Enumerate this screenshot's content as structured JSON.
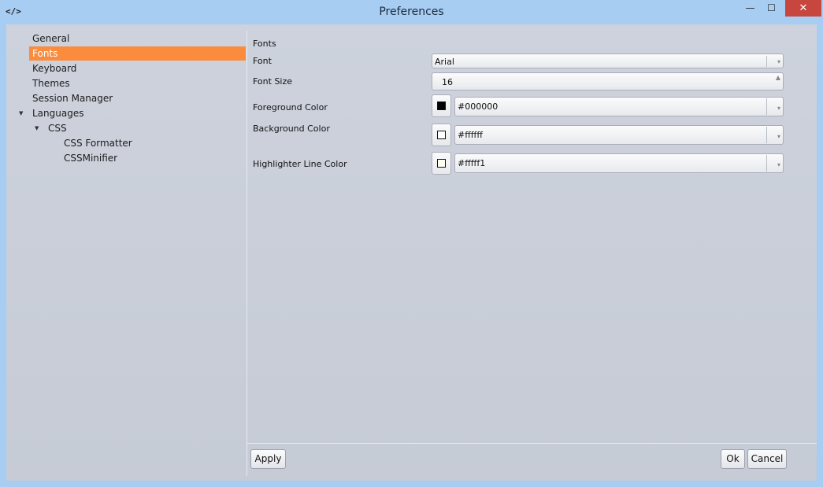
{
  "window": {
    "title": "Preferences",
    "app_icon": "</>",
    "controls": {
      "minimize": "—",
      "maximize": "☐",
      "close": "✕"
    }
  },
  "sidebar": {
    "items": [
      {
        "label": "General"
      },
      {
        "label": "Fonts",
        "selected": true
      },
      {
        "label": "Keyboard"
      },
      {
        "label": "Themes"
      },
      {
        "label": "Session Manager"
      },
      {
        "label": "Languages",
        "expanded": true
      },
      {
        "label": "CSS",
        "expanded": true
      },
      {
        "label": "CSS Formatter"
      },
      {
        "label": "CSSMinifier"
      }
    ],
    "expander_glyph": "▼"
  },
  "fonts": {
    "section_title": "Fonts",
    "font_label": "Font",
    "font_value": "Arial",
    "size_label": "Font Size",
    "size_value": "16",
    "foreground_label": "Foreground Color",
    "foreground_value": "#000000",
    "foreground_swatch": "#000000",
    "background_label": "Background Color",
    "background_value": "#ffffff",
    "background_swatch": "#ffffff",
    "highlighter_label": "Highlighter Line Color",
    "highlighter_value": "#fffff1",
    "highlighter_swatch": "#fffff1"
  },
  "buttons": {
    "apply": "Apply",
    "ok": "Ok",
    "cancel": "Cancel"
  },
  "colors": {
    "selection": "#fb8c3d",
    "titlebar": "#a8cdf3",
    "close": "#c7473f"
  }
}
